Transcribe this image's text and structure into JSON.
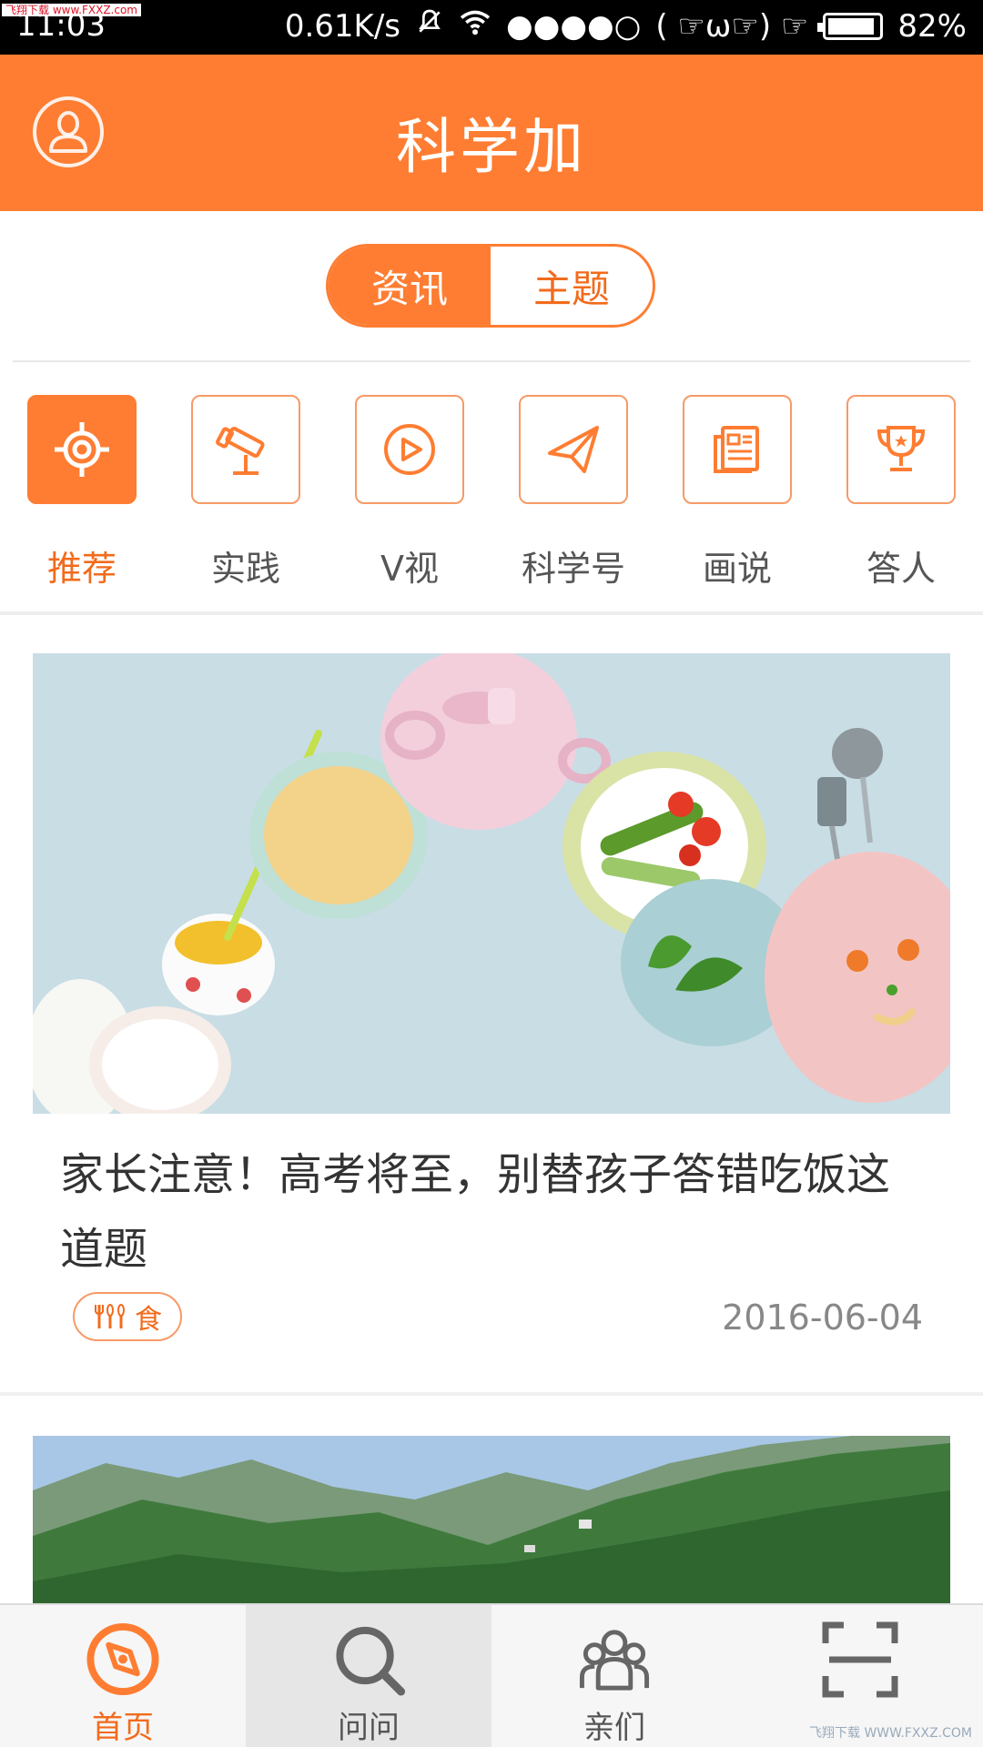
{
  "status_bar": {
    "time": "11:03",
    "watermark": "飞翔下载 www.FXXZ.com",
    "net_speed": "0.61K/s",
    "signal": "●●●●○",
    "emoji": "( ☞ω☞) ☞",
    "battery": "82%",
    "battery_level": 0.82
  },
  "header": {
    "title": "科学加",
    "profile_icon": "user-icon"
  },
  "segment": {
    "tabs": [
      {
        "label": "资讯",
        "active": true
      },
      {
        "label": "主题",
        "active": false
      }
    ]
  },
  "categories": [
    {
      "label": "推荐",
      "icon": "target-icon",
      "active": true
    },
    {
      "label": "实践",
      "icon": "telescope-icon",
      "active": false
    },
    {
      "label": "V视",
      "icon": "play-icon",
      "active": false
    },
    {
      "label": "科学号",
      "icon": "paper-plane-icon",
      "active": false
    },
    {
      "label": "画说",
      "icon": "newspaper-icon",
      "active": false
    },
    {
      "label": "答人",
      "icon": "trophy-icon",
      "active": false
    }
  ],
  "articles": [
    {
      "title": "家长注意！高考将至，别替孩子答错吃饭这道题",
      "tag": "食",
      "tag_icon": "utensils-icon",
      "date": "2016-06-04"
    }
  ],
  "bottom_nav": [
    {
      "label": "首页",
      "icon": "compass-icon",
      "active": true
    },
    {
      "label": "问问",
      "icon": "search-icon",
      "active": false
    },
    {
      "label": "亲们",
      "icon": "people-icon",
      "active": false
    },
    {
      "label": "",
      "icon": "scan-icon",
      "active": false
    }
  ],
  "footer_watermark": "飞翔下载 WWW.FXXZ.COM",
  "colors": {
    "accent": "#fe7d32",
    "accent_text": "#f26b1d",
    "border_orange": "#f79a66"
  }
}
